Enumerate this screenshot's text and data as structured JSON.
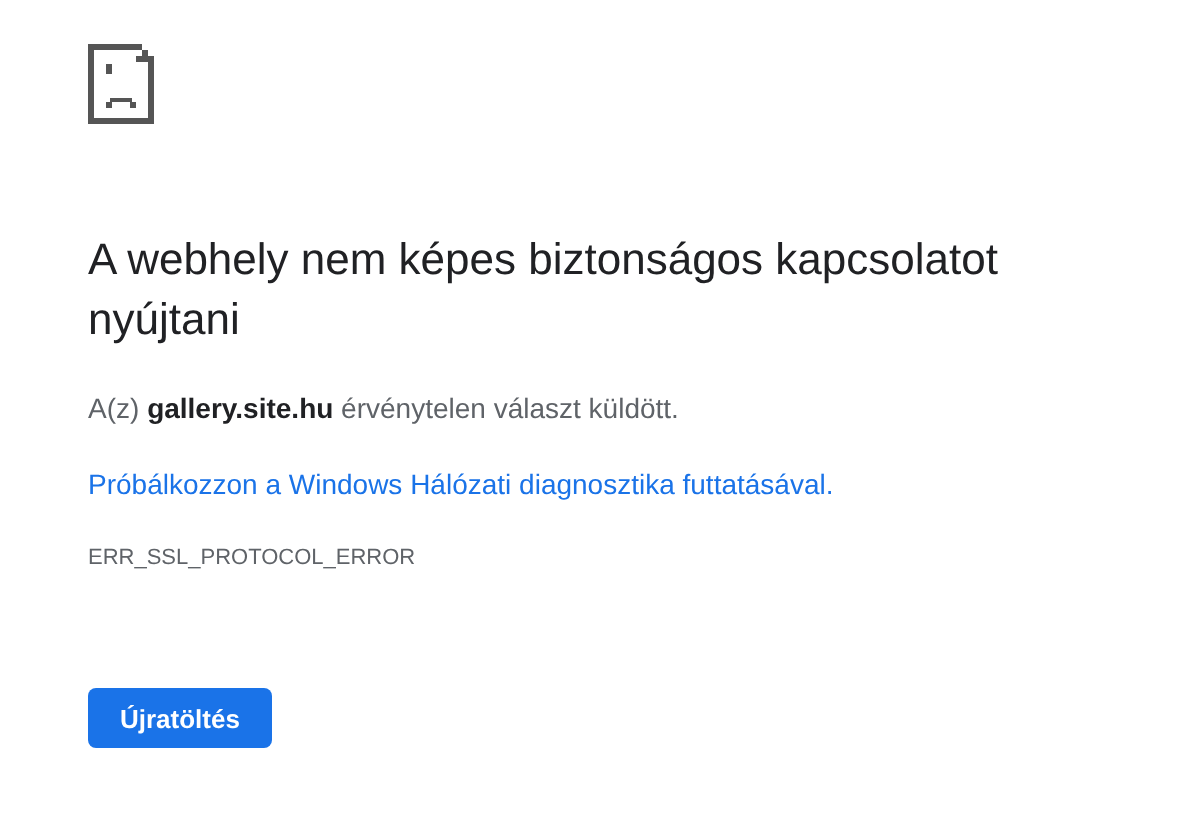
{
  "heading": "A webhely nem képes biztonságos kapcsolatot nyújtani",
  "summary": "A(z) **gallery.site.hu** érvénytelen választ küldött.",
  "suggestion": {
    "link": "Próbálkozzon a Windows Hálózati diagnosztika futtatásával",
    "tail": "."
  },
  "error_code": "ERR_SSL_PROTOCOL_ERROR",
  "buttons": [
    {
      "label": "Újratöltés",
      "kind": "primary"
    }
  ]
}
